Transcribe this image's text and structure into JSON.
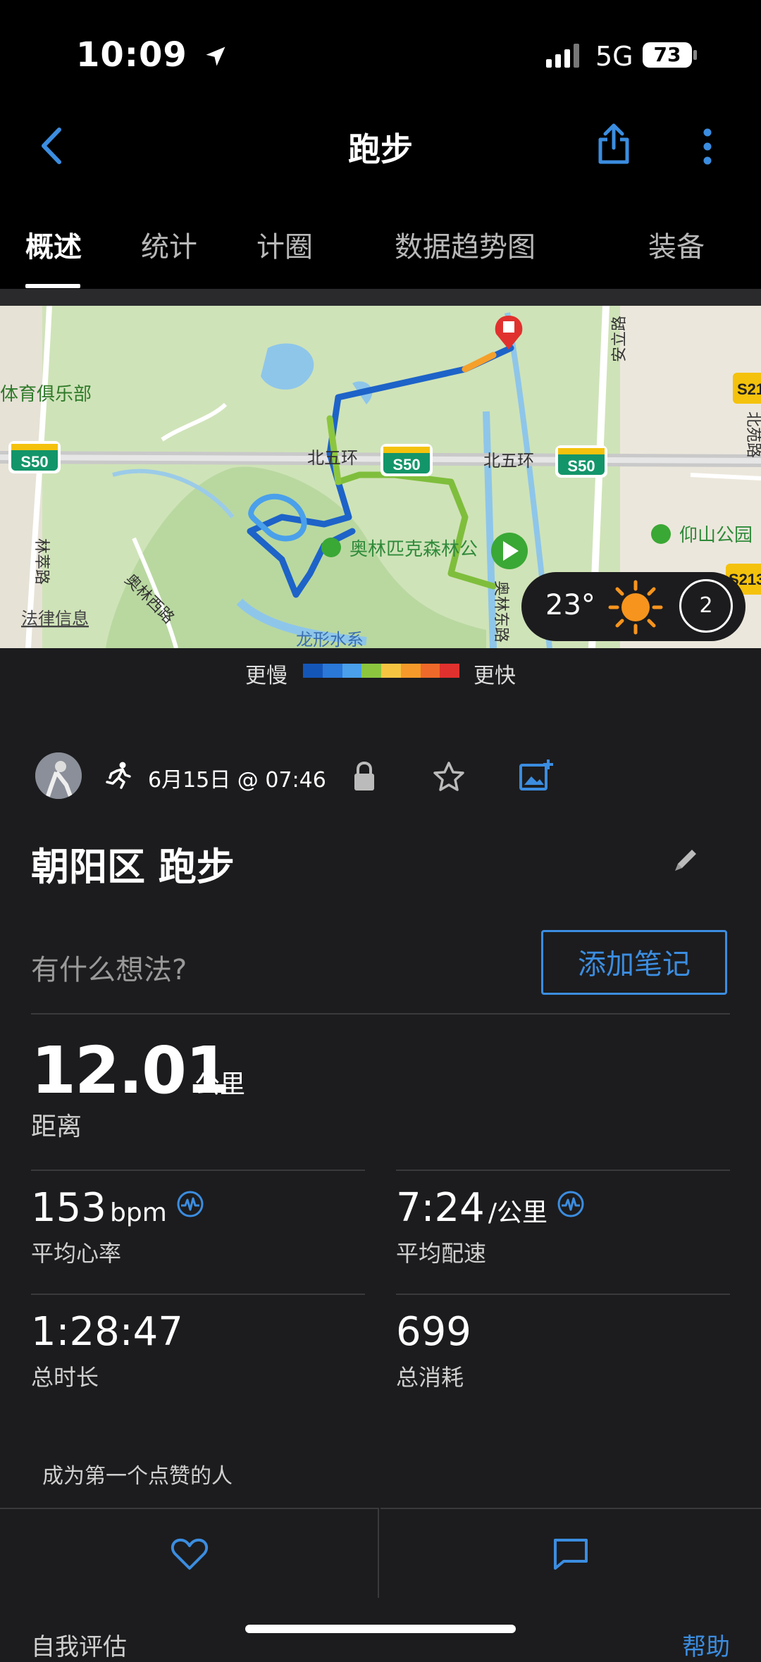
{
  "status_bar": {
    "time": "10:09",
    "network": "5G",
    "battery": "73"
  },
  "nav": {
    "title": "跑步"
  },
  "tabs": [
    {
      "label": "概述"
    },
    {
      "label": "统计"
    },
    {
      "label": "计圈"
    },
    {
      "label": "数据趋势图"
    },
    {
      "label": "装备"
    }
  ],
  "map": {
    "labels": {
      "ring_road_left": "北五环",
      "ring_road_right": "北五环",
      "park": "奥林匹克森林公",
      "yangshan_park": "仰山公园",
      "anli_road": "安立路",
      "club": "体育俱乐部",
      "lincui_road": "林萃路",
      "aolin_west": "奥林西路",
      "aolin_east": "奥林东路",
      "dragon_water": "龙形水系",
      "beiyuan": "北苑路",
      "legal": "法律信息"
    },
    "highway_shields": [
      "S50",
      "S50",
      "S50",
      "S21",
      "S213"
    ],
    "weather": {
      "temp": "23°",
      "wind": "2"
    }
  },
  "legend": {
    "slow": "更慢",
    "fast": "更快",
    "colors": [
      "#1456b8",
      "#2a78d8",
      "#4aa0ea",
      "#8cc63f",
      "#f5c542",
      "#f59a2a",
      "#ef6a2a",
      "#e0312e"
    ]
  },
  "activity": {
    "date": "6月15日 @ 07:46",
    "title": "朝阳区 跑步",
    "thoughts_placeholder": "有什么想法?",
    "add_note": "添加笔记"
  },
  "stats": {
    "distance": {
      "value": "12.01",
      "unit": "公里",
      "label": "距离"
    },
    "avg_hr": {
      "value": "153",
      "unit": "bpm",
      "label": "平均心率"
    },
    "avg_pace": {
      "value": "7:24",
      "unit": "/公里",
      "label": "平均配速"
    },
    "total_time": {
      "value": "1:28:47",
      "label": "总时长"
    },
    "calories": {
      "value": "699",
      "label": "总消耗"
    }
  },
  "social": {
    "first_like": "成为第一个点赞的人"
  },
  "bottom": {
    "self_eval": "自我评估",
    "help": "帮助"
  },
  "accent_color": "#3b8de0"
}
